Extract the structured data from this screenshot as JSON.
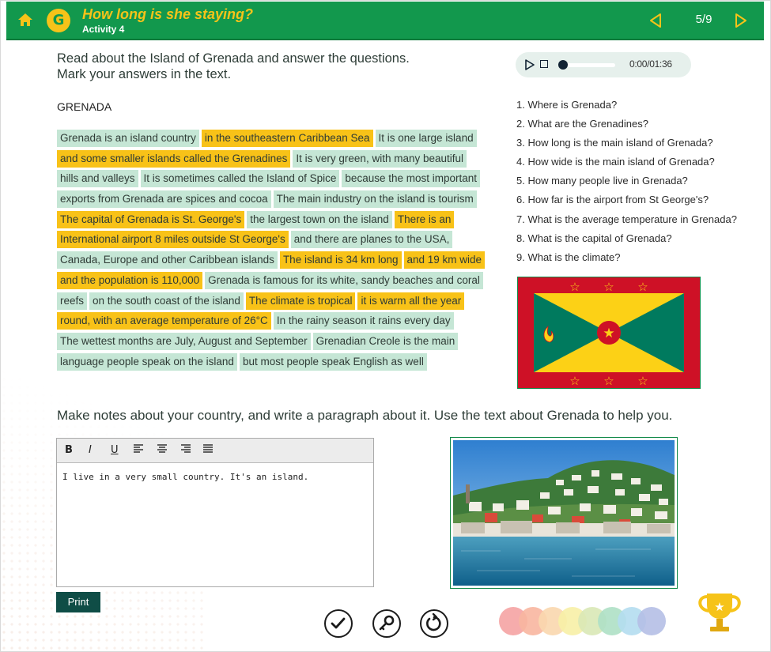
{
  "header": {
    "badge_letter": "G",
    "title": "How long is she staying?",
    "subtitle": "Activity 4",
    "page": "5/9"
  },
  "instructions": {
    "line1": "Read about the Island of Grenada and answer the questions.",
    "line2": "Mark your answers in the text."
  },
  "audio": {
    "time": "0:00/01:36",
    "progress": 0
  },
  "passage": {
    "heading": "GRENADA",
    "lines": [
      [
        [
          "Grenada is an island country",
          "g"
        ],
        [
          "in the southeastern Caribbean Sea",
          "y"
        ],
        [
          "It is one large island",
          "g"
        ]
      ],
      [
        [
          "and some smaller islands called the Grenadines",
          "y"
        ],
        [
          "It is very green, with many beautiful",
          "g"
        ]
      ],
      [
        [
          "hills and valleys",
          "g"
        ],
        [
          "It is sometimes called the Island of Spice",
          "g"
        ],
        [
          "because the most important",
          "g"
        ]
      ],
      [
        [
          "exports from Grenada are spices and cocoa",
          "g"
        ],
        [
          "The main industry on the island is tourism",
          "g"
        ]
      ],
      [
        [
          "The capital of Grenada is St. George's",
          "y"
        ],
        [
          "the largest town on the island",
          "g"
        ],
        [
          "There is an",
          "y"
        ]
      ],
      [
        [
          "International airport 8 miles outside St George's",
          "y"
        ],
        [
          "and there are planes to the USA,",
          "g"
        ]
      ],
      [
        [
          "Canada, Europe and other Caribbean islands",
          "g"
        ],
        [
          "The island is 34 km long",
          "y"
        ],
        [
          "and 19 km wide",
          "y"
        ]
      ],
      [
        [
          "and the population is 110,000",
          "y"
        ],
        [
          "Grenada is famous for its white, sandy beaches and coral",
          "g"
        ]
      ],
      [
        [
          "reefs",
          "g"
        ],
        [
          "on the south coast of the island",
          "g"
        ],
        [
          "The climate is tropical",
          "y"
        ],
        [
          "it is warm all the year",
          "y"
        ]
      ],
      [
        [
          "round, with an average temperature of 26°C",
          "y"
        ],
        [
          "In the rainy season it rains every day",
          "g"
        ]
      ],
      [
        [
          "The wettest months are July, August and September",
          "g"
        ],
        [
          "Grenadian Creole is the main",
          "g"
        ]
      ],
      [
        [
          "language people speak on the island",
          "g"
        ],
        [
          "but most people speak English as well",
          "g"
        ]
      ]
    ]
  },
  "questions": [
    "1. Where is Grenada?",
    "2. What are the Grenadines?",
    "3. How long is the main island of Grenada?",
    "4. How wide is the main island of Grenada?",
    "5. How many people live in Grenada?",
    "6. How far is the airport from St George's?",
    "7. What is the average temperature in Grenada?",
    "8. What is the capital of Grenada?",
    "9. What is the climate?"
  ],
  "notes": {
    "instruction": "Make notes about your country, and write a paragraph about it. Use the text about Grenada to help you.",
    "toolbar": {
      "bold": "B",
      "italic": "I",
      "underline": "U"
    },
    "text": "I live in a very small country. It's an island.",
    "print_label": "Print"
  },
  "colors": {
    "header_green": "#12984d",
    "accent_yellow": "#f6c319",
    "highlight_green": "#c5e6d5",
    "highlight_yellow": "#f8c218",
    "palette": [
      "#f5a3a3",
      "#f8b6a0",
      "#f9d7ae",
      "#f7f0a6",
      "#d9e8b6",
      "#aee0c5",
      "#b4ddef",
      "#b5bfe6"
    ]
  },
  "icons": [
    "home-icon",
    "prev-arrow-icon",
    "next-arrow-icon",
    "play-icon",
    "stop-icon",
    "check-icon",
    "key-icon",
    "reset-icon",
    "trophy-icon"
  ]
}
